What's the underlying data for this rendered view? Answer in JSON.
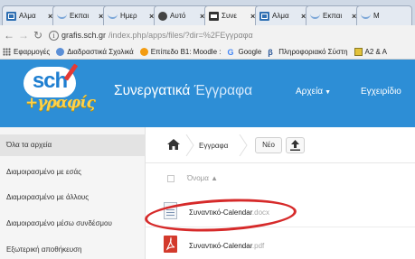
{
  "browser": {
    "tabs": [
      {
        "icon": "grid-icon",
        "title": "Αλμα",
        "active": false
      },
      {
        "icon": "wave-icon",
        "title": "Εκπαι",
        "active": false
      },
      {
        "icon": "wave-icon",
        "title": "Ημερ",
        "active": false
      },
      {
        "icon": "circle-icon",
        "title": "Αυτό",
        "active": false
      },
      {
        "icon": "box-icon",
        "title": "Συνε",
        "active": true
      },
      {
        "icon": "grid-icon",
        "title": "Αλμα",
        "active": false
      },
      {
        "icon": "wave-icon",
        "title": "Εκπαι",
        "active": false
      },
      {
        "icon": "wave-icon",
        "title": "Μ",
        "active": false
      }
    ],
    "close_glyph": "×",
    "url_host": "grafis.sch.gr",
    "url_path": "/index.php/apps/files/?dir=%2FΕγγραφα",
    "bookmarks": [
      {
        "icon": "apps-icon",
        "label": "Εφαρμογές"
      },
      {
        "icon": "gear-icon",
        "label": "Διαδραστικά Σχολικά"
      },
      {
        "icon": "moodle-icon",
        "label": "Επίπεδο Β1: Moodle :"
      },
      {
        "icon": "google-icon",
        "label": "Google"
      },
      {
        "icon": "beta-icon",
        "label": "Πληροφοριακό Σύστη"
      },
      {
        "icon": "card-icon",
        "label": "A2 & A"
      }
    ]
  },
  "site": {
    "logo_sch": "sch",
    "logo_grafis": "+γραφίς",
    "title_bold": "Συνεργατικά",
    "title_light": "Έγγραφα",
    "nav_files": "Αρχεία",
    "nav_next": "Εγχειρίδιο"
  },
  "sidebar": {
    "items": [
      {
        "label": "Όλα τα αρχεία",
        "active": true
      },
      {
        "label": "Διαμοιρασμένο με εσάς",
        "active": false
      },
      {
        "label": "Διαμοιρασμένο με άλλους",
        "active": false
      },
      {
        "label": "Διαμοιρασμένο μέσω συνδέσμου",
        "active": false
      },
      {
        "label": "Εξωτερική αποθήκευση",
        "active": false
      }
    ]
  },
  "main": {
    "breadcrumb": "Εγγραφα",
    "new_button": "Νέο",
    "column_name": "Όνομα ▲",
    "files": [
      {
        "name": "Συναντικό-Calendar",
        "ext": ".docx",
        "icon": "doc-icon"
      },
      {
        "name": "Συναντικό-Calendar",
        "ext": ".pdf",
        "icon": "pdf-icon"
      }
    ]
  },
  "colors": {
    "header_blue": "#2d8ed6",
    "highlight_red": "#d62a2a",
    "logo_yellow": "#ffd24a"
  }
}
